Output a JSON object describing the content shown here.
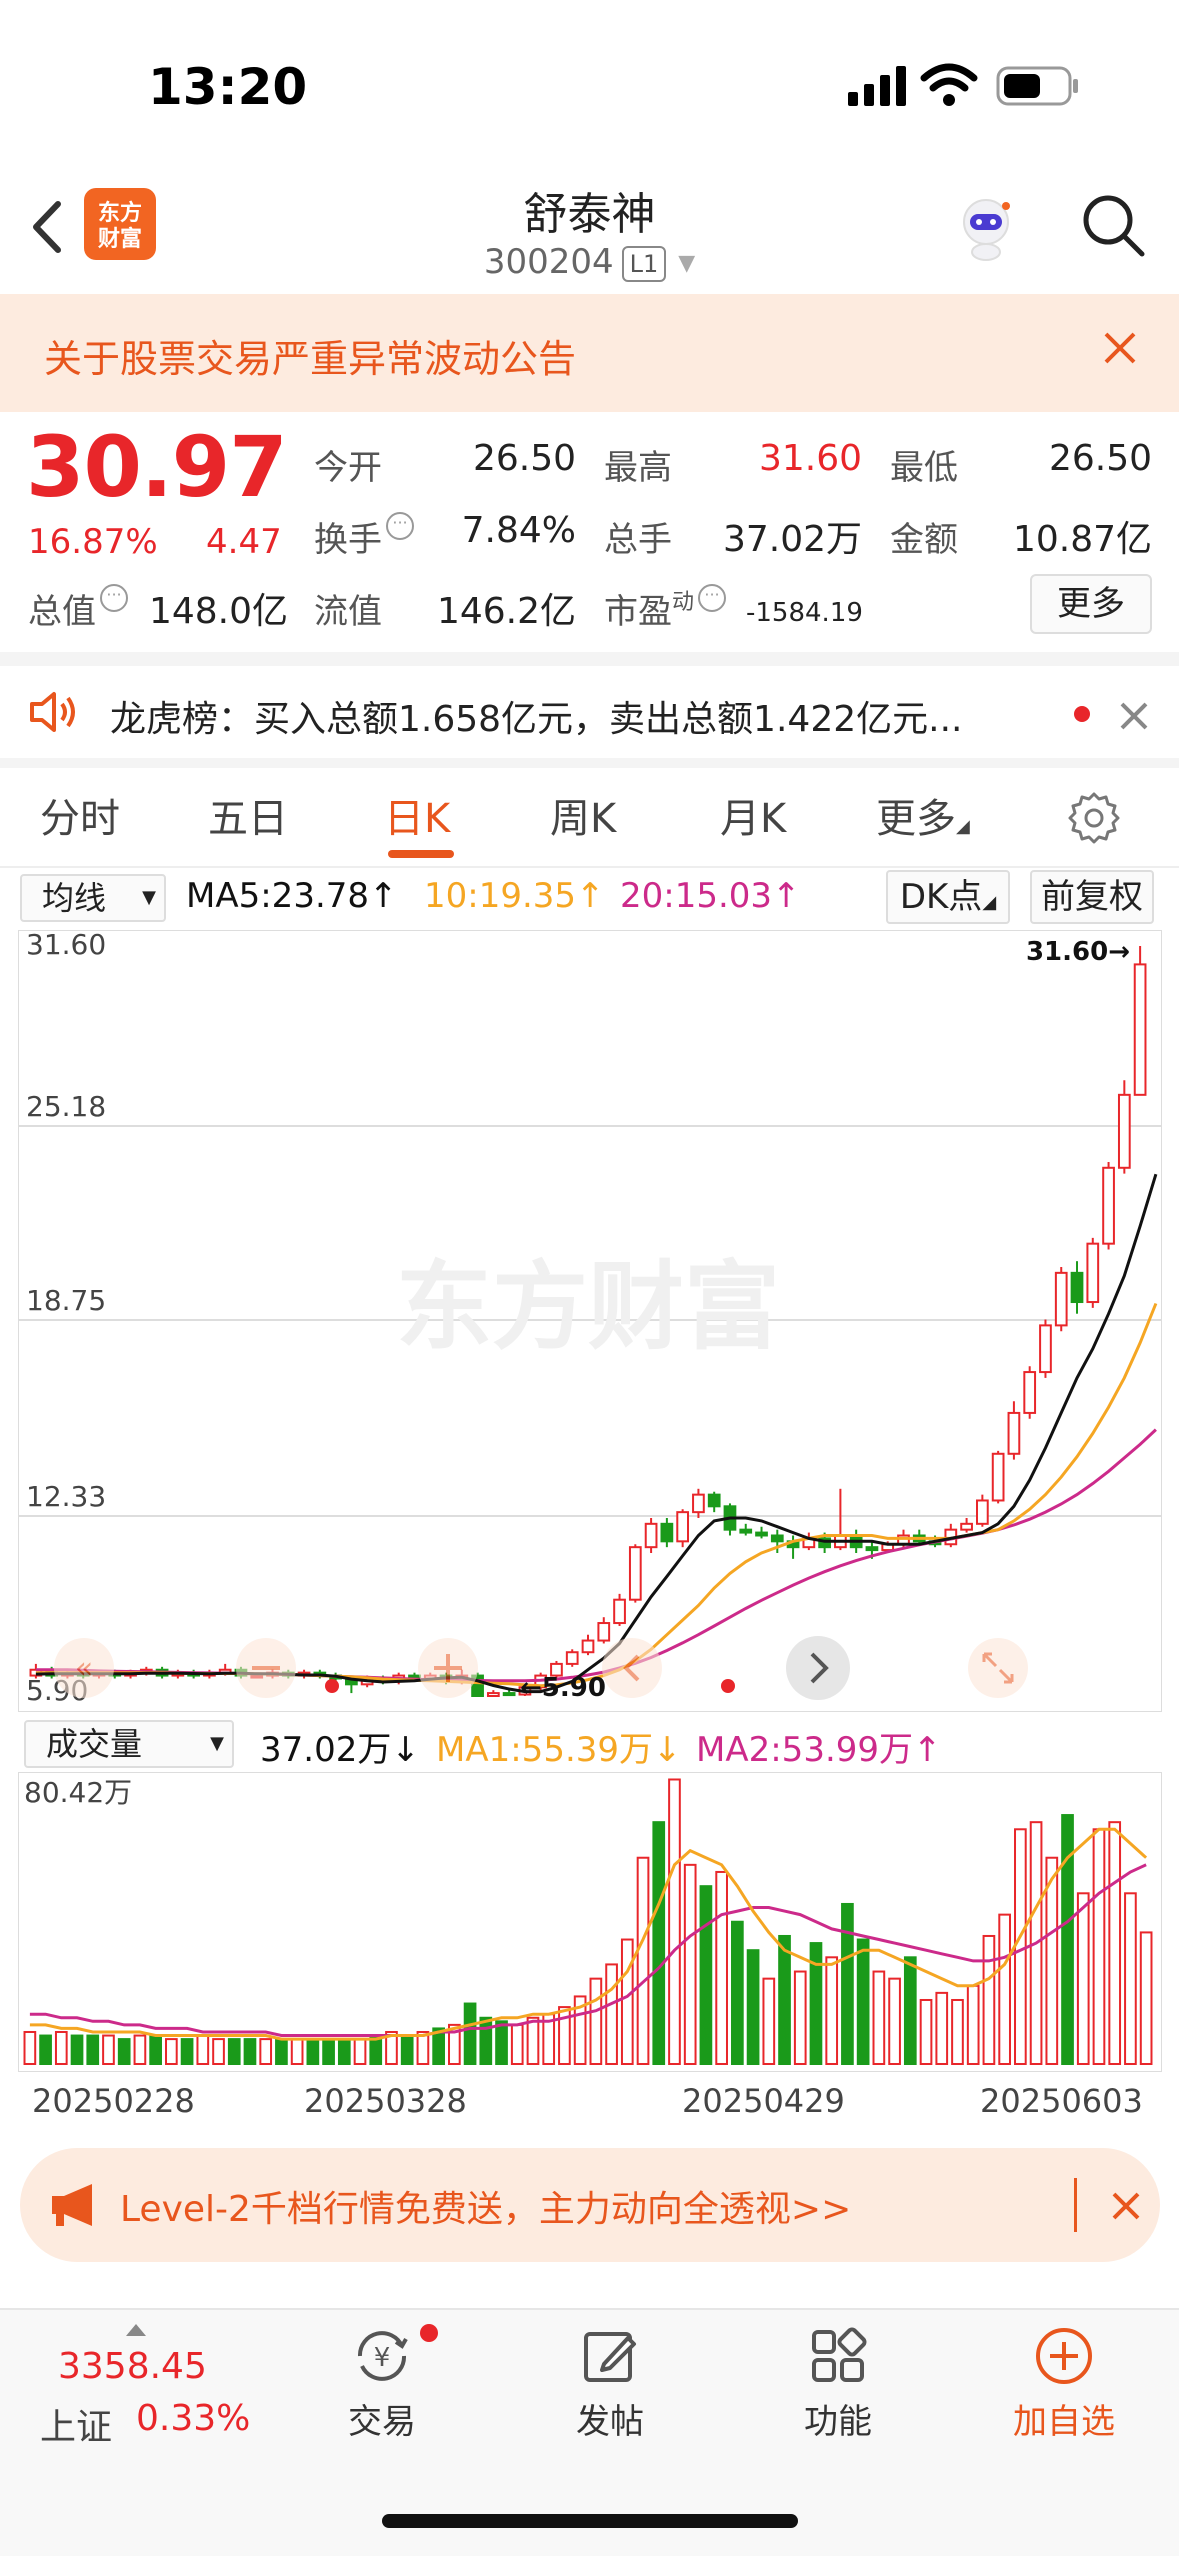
{
  "status_bar": {
    "time": "13:20"
  },
  "header": {
    "stock_name": "舒泰神",
    "stock_code": "300204",
    "level_badge": "L1",
    "logo_text": "东方财富"
  },
  "notice": {
    "text": "关于股票交易严重异常波动公告"
  },
  "quote": {
    "price": "30.97",
    "change_pct": "16.87%",
    "change": "4.47",
    "fields": {
      "open_label": "今开",
      "open": "26.50",
      "high_label": "最高",
      "high": "31.60",
      "low_label": "最低",
      "low": "26.50",
      "turnover_label": "换手",
      "turnover": "7.84%",
      "volume_label": "总手",
      "volume": "37.02万",
      "amount_label": "金额",
      "amount": "10.87亿",
      "mktcap_label": "总值",
      "mktcap": "148.0亿",
      "float_label": "流值",
      "float_cap": "146.2亿",
      "pe_label": "市盈",
      "pe_sup": "动",
      "pe": "-1584.19"
    },
    "more_label": "更多"
  },
  "dragon_tiger": {
    "text": "龙虎榜：买入总额1.658亿元，卖出总额1.422亿元..."
  },
  "tabs": [
    {
      "label": "分时"
    },
    {
      "label": "五日"
    },
    {
      "label": "日K"
    },
    {
      "label": "周K"
    },
    {
      "label": "月K"
    },
    {
      "label": "更多"
    }
  ],
  "ma_bar": {
    "select": "均线",
    "ma5": "MA5:23.78↑",
    "ma10": "10:19.35↑",
    "ma20": "20:15.03↑",
    "dk_label": "DK点",
    "adjust_label": "前复权"
  },
  "chart_labels": {
    "y_ticks": [
      "31.60",
      "25.18",
      "18.75",
      "12.33",
      "5.90"
    ],
    "high_marker": "31.60→",
    "low_marker": "←5.90",
    "watermark": "东方财富"
  },
  "volume_bar": {
    "select": "成交量",
    "vol": "37.02万↓",
    "ma1": "MA1:55.39万↓",
    "ma2": "MA2:53.99万↑",
    "max_label": "80.42万"
  },
  "dates": [
    "20250228",
    "20250328",
    "20250429",
    "20250603"
  ],
  "colors": {
    "up": "#e8262a",
    "down": "#1a9a1a",
    "ma5": "#111111",
    "ma10": "#f5a623",
    "ma20": "#cc2a8a",
    "accent": "#e8561d"
  },
  "chart_data": {
    "type": "candlestick",
    "y_range": [
      5.9,
      31.6
    ],
    "candles": [
      {
        "o": 6.6,
        "c": 6.8,
        "h": 7.0,
        "l": 6.5
      },
      {
        "o": 6.8,
        "c": 6.6,
        "h": 6.9,
        "l": 6.5
      },
      {
        "o": 6.6,
        "c": 6.7,
        "h": 6.8,
        "l": 6.5
      },
      {
        "o": 6.7,
        "c": 6.6,
        "h": 6.8,
        "l": 6.5
      },
      {
        "o": 6.6,
        "c": 6.7,
        "h": 6.8,
        "l": 6.5
      },
      {
        "o": 6.7,
        "c": 6.6,
        "h": 6.8,
        "l": 6.5
      },
      {
        "o": 6.6,
        "c": 6.7,
        "h": 6.8,
        "l": 6.5
      },
      {
        "o": 6.7,
        "c": 6.8,
        "h": 6.9,
        "l": 6.6
      },
      {
        "o": 6.8,
        "c": 6.6,
        "h": 6.9,
        "l": 6.5
      },
      {
        "o": 6.6,
        "c": 6.7,
        "h": 6.8,
        "l": 6.5
      },
      {
        "o": 6.7,
        "c": 6.6,
        "h": 6.8,
        "l": 6.5
      },
      {
        "o": 6.6,
        "c": 6.7,
        "h": 6.8,
        "l": 6.5
      },
      {
        "o": 6.7,
        "c": 6.8,
        "h": 7.0,
        "l": 6.6
      },
      {
        "o": 6.8,
        "c": 6.6,
        "h": 6.9,
        "l": 6.5
      },
      {
        "o": 6.6,
        "c": 6.6,
        "h": 6.7,
        "l": 6.5
      },
      {
        "o": 6.6,
        "c": 6.7,
        "h": 6.8,
        "l": 6.5
      },
      {
        "o": 6.7,
        "c": 6.6,
        "h": 6.8,
        "l": 6.5
      },
      {
        "o": 6.6,
        "c": 6.7,
        "h": 6.8,
        "l": 6.5
      },
      {
        "o": 6.7,
        "c": 6.6,
        "h": 6.8,
        "l": 6.5
      },
      {
        "o": 6.6,
        "c": 6.5,
        "h": 6.7,
        "l": 6.4
      },
      {
        "o": 6.5,
        "c": 6.3,
        "h": 6.6,
        "l": 6.0
      },
      {
        "o": 6.3,
        "c": 6.5,
        "h": 6.6,
        "l": 6.2
      },
      {
        "o": 6.5,
        "c": 6.4,
        "h": 6.6,
        "l": 6.3
      },
      {
        "o": 6.4,
        "c": 6.6,
        "h": 6.7,
        "l": 6.3
      },
      {
        "o": 6.6,
        "c": 6.5,
        "h": 6.7,
        "l": 6.4
      },
      {
        "o": 6.5,
        "c": 6.6,
        "h": 6.7,
        "l": 6.4
      },
      {
        "o": 6.6,
        "c": 6.4,
        "h": 6.7,
        "l": 6.3
      },
      {
        "o": 6.4,
        "c": 6.6,
        "h": 6.8,
        "l": 6.3
      },
      {
        "o": 6.6,
        "c": 5.9,
        "h": 6.7,
        "l": 5.9
      },
      {
        "o": 5.9,
        "c": 6.0,
        "h": 6.1,
        "l": 5.9
      },
      {
        "o": 6.0,
        "c": 5.95,
        "h": 6.1,
        "l": 5.9
      },
      {
        "o": 5.95,
        "c": 6.2,
        "h": 6.3,
        "l": 5.9
      },
      {
        "o": 6.2,
        "c": 6.6,
        "h": 6.7,
        "l": 6.1
      },
      {
        "o": 6.6,
        "c": 7.0,
        "h": 7.1,
        "l": 6.5
      },
      {
        "o": 7.0,
        "c": 7.4,
        "h": 7.5,
        "l": 6.9
      },
      {
        "o": 7.4,
        "c": 7.8,
        "h": 8.0,
        "l": 7.3
      },
      {
        "o": 7.8,
        "c": 8.4,
        "h": 8.6,
        "l": 7.7
      },
      {
        "o": 8.4,
        "c": 9.2,
        "h": 9.4,
        "l": 8.3
      },
      {
        "o": 9.2,
        "c": 11.0,
        "h": 11.1,
        "l": 9.1
      },
      {
        "o": 11.0,
        "c": 11.8,
        "h": 12.0,
        "l": 10.8
      },
      {
        "o": 11.8,
        "c": 11.2,
        "h": 12.0,
        "l": 11.0
      },
      {
        "o": 11.2,
        "c": 12.2,
        "h": 12.3,
        "l": 11.0
      },
      {
        "o": 12.2,
        "c": 12.8,
        "h": 13.0,
        "l": 12.0
      },
      {
        "o": 12.8,
        "c": 12.4,
        "h": 12.9,
        "l": 12.2
      },
      {
        "o": 12.4,
        "c": 11.6,
        "h": 12.5,
        "l": 11.4
      },
      {
        "o": 11.6,
        "c": 11.5,
        "h": 11.8,
        "l": 11.4
      },
      {
        "o": 11.5,
        "c": 11.4,
        "h": 11.7,
        "l": 11.3
      },
      {
        "o": 11.4,
        "c": 11.2,
        "h": 11.6,
        "l": 10.8
      },
      {
        "o": 11.2,
        "c": 11.0,
        "h": 11.4,
        "l": 10.6
      },
      {
        "o": 11.0,
        "c": 11.3,
        "h": 11.5,
        "l": 10.9
      },
      {
        "o": 11.3,
        "c": 11.0,
        "h": 11.5,
        "l": 10.8
      },
      {
        "o": 11.0,
        "c": 11.4,
        "h": 13.0,
        "l": 10.9
      },
      {
        "o": 11.4,
        "c": 11.0,
        "h": 11.6,
        "l": 10.8
      },
      {
        "o": 11.0,
        "c": 10.9,
        "h": 11.2,
        "l": 10.6
      },
      {
        "o": 10.9,
        "c": 11.1,
        "h": 11.2,
        "l": 10.8
      },
      {
        "o": 11.1,
        "c": 11.4,
        "h": 11.6,
        "l": 11.0
      },
      {
        "o": 11.4,
        "c": 11.2,
        "h": 11.6,
        "l": 11.1
      },
      {
        "o": 11.2,
        "c": 11.1,
        "h": 11.4,
        "l": 11.0
      },
      {
        "o": 11.1,
        "c": 11.6,
        "h": 11.8,
        "l": 11.0
      },
      {
        "o": 11.6,
        "c": 11.8,
        "h": 12.0,
        "l": 11.5
      },
      {
        "o": 11.8,
        "c": 12.6,
        "h": 12.8,
        "l": 11.7
      },
      {
        "o": 12.6,
        "c": 14.2,
        "h": 14.3,
        "l": 12.5
      },
      {
        "o": 14.2,
        "c": 15.6,
        "h": 16.0,
        "l": 14.0
      },
      {
        "o": 15.6,
        "c": 17.0,
        "h": 17.2,
        "l": 15.4
      },
      {
        "o": 17.0,
        "c": 18.6,
        "h": 18.8,
        "l": 16.8
      },
      {
        "o": 18.6,
        "c": 20.4,
        "h": 20.6,
        "l": 18.4
      },
      {
        "o": 20.4,
        "c": 19.4,
        "h": 20.8,
        "l": 19.0
      },
      {
        "o": 19.4,
        "c": 21.4,
        "h": 21.6,
        "l": 19.2
      },
      {
        "o": 21.4,
        "c": 24.0,
        "h": 24.2,
        "l": 21.2
      },
      {
        "o": 24.0,
        "c": 26.5,
        "h": 27.0,
        "l": 23.8
      },
      {
        "o": 26.5,
        "c": 30.97,
        "h": 31.6,
        "l": 26.5
      }
    ],
    "ma5_points": [
      6.65,
      6.66,
      6.66,
      6.66,
      6.66,
      6.66,
      6.66,
      6.68,
      6.68,
      6.68,
      6.67,
      6.66,
      6.68,
      6.68,
      6.66,
      6.66,
      6.64,
      6.62,
      6.62,
      6.58,
      6.48,
      6.42,
      6.38,
      6.4,
      6.42,
      6.48,
      6.52,
      6.54,
      6.42,
      6.26,
      6.14,
      6.05,
      6.05,
      6.2,
      6.4,
      6.8,
      7.2,
      7.7,
      8.5,
      9.3,
      10.0,
      10.7,
      11.4,
      11.9,
      12.0,
      12.0,
      11.9,
      11.7,
      11.5,
      11.3,
      11.2,
      11.2,
      11.2,
      11.2,
      11.1,
      11.1,
      11.1,
      11.2,
      11.3,
      11.4,
      11.5,
      11.8,
      12.4,
      13.3,
      14.4,
      15.6,
      16.8,
      17.8,
      19.0,
      20.3,
      22.0,
      23.78
    ],
    "ma10_points": [
      6.7,
      6.7,
      6.7,
      6.7,
      6.7,
      6.7,
      6.7,
      6.7,
      6.7,
      6.68,
      6.67,
      6.67,
      6.67,
      6.67,
      6.66,
      6.65,
      6.64,
      6.62,
      6.6,
      6.58,
      6.56,
      6.52,
      6.48,
      6.46,
      6.44,
      6.42,
      6.4,
      6.38,
      6.36,
      6.34,
      6.32,
      6.28,
      6.25,
      6.28,
      6.35,
      6.46,
      6.6,
      6.8,
      7.1,
      7.5,
      8.0,
      8.5,
      9.0,
      9.6,
      10.1,
      10.5,
      10.8,
      11.0,
      11.2,
      11.3,
      11.4,
      11.4,
      11.4,
      11.4,
      11.3,
      11.3,
      11.3,
      11.3,
      11.3,
      11.4,
      11.5,
      11.6,
      11.9,
      12.3,
      12.8,
      13.4,
      14.1,
      14.9,
      15.8,
      16.8,
      18.0,
      19.35
    ],
    "ma20_points": [
      6.8,
      6.8,
      6.8,
      6.78,
      6.76,
      6.75,
      6.74,
      6.73,
      6.72,
      6.71,
      6.7,
      6.69,
      6.68,
      6.67,
      6.66,
      6.65,
      6.64,
      6.62,
      6.6,
      6.58,
      6.56,
      6.54,
      6.52,
      6.5,
      6.48,
      6.46,
      6.45,
      6.44,
      6.43,
      6.42,
      6.42,
      6.42,
      6.44,
      6.48,
      6.54,
      6.62,
      6.72,
      6.86,
      7.02,
      7.22,
      7.46,
      7.72,
      8.0,
      8.3,
      8.6,
      8.9,
      9.18,
      9.44,
      9.7,
      9.94,
      10.16,
      10.36,
      10.54,
      10.7,
      10.84,
      10.96,
      11.08,
      11.18,
      11.28,
      11.38,
      11.48,
      11.6,
      11.76,
      11.96,
      12.2,
      12.48,
      12.8,
      13.18,
      13.6,
      14.06,
      14.52,
      15.03
    ],
    "volume_max": 80.42,
    "volumes": [
      9,
      8,
      9,
      8,
      8,
      8,
      7,
      8,
      8,
      7,
      7,
      8,
      7,
      7,
      7,
      7,
      7,
      7,
      7,
      7,
      7,
      7,
      8,
      9,
      8,
      9,
      10,
      11,
      17,
      13,
      12,
      11,
      13,
      14,
      16,
      19,
      24,
      28,
      35,
      58,
      68,
      80,
      56,
      50,
      54,
      40,
      32,
      24,
      36,
      26,
      34,
      30,
      45,
      35,
      26,
      24,
      30,
      18,
      20,
      18,
      22,
      36,
      42,
      66,
      68,
      58,
      70,
      48,
      66,
      68,
      48,
      37
    ],
    "volume_up": [
      1,
      0,
      1,
      0,
      0,
      1,
      0,
      1,
      0,
      1,
      0,
      1,
      1,
      0,
      0,
      1,
      0,
      1,
      0,
      0,
      0,
      1,
      0,
      1,
      0,
      1,
      0,
      1,
      0,
      0,
      0,
      1,
      1,
      1,
      1,
      1,
      1,
      1,
      1,
      1,
      0,
      1,
      1,
      0,
      1,
      0,
      0,
      1,
      0,
      1,
      0,
      1,
      0,
      0,
      1,
      1,
      0,
      1,
      1,
      1,
      1,
      1,
      1,
      1,
      1,
      1,
      0,
      1,
      1,
      1,
      1,
      1
    ],
    "volume_ma1": [
      11,
      11,
      10,
      10,
      9,
      9,
      9,
      9,
      8,
      8,
      8,
      8,
      8,
      8,
      8,
      8,
      7,
      7,
      7,
      7,
      7,
      7,
      7,
      8,
      8,
      8,
      9,
      10,
      11,
      12,
      13,
      13,
      14,
      14,
      15,
      16,
      18,
      21,
      26,
      35,
      45,
      56,
      60,
      58,
      56,
      50,
      43,
      37,
      32,
      30,
      28,
      28,
      30,
      32,
      32,
      30,
      28,
      26,
      24,
      22,
      22,
      24,
      28,
      36,
      44,
      52,
      58,
      62,
      66,
      66,
      62,
      58
    ],
    "volume_ma2": [
      14,
      14,
      13,
      13,
      12,
      12,
      11,
      11,
      10,
      10,
      10,
      9,
      9,
      9,
      9,
      9,
      8,
      8,
      8,
      8,
      8,
      8,
      8,
      8,
      8,
      8,
      9,
      9,
      10,
      10,
      11,
      11,
      12,
      12,
      13,
      14,
      15,
      17,
      19,
      23,
      27,
      32,
      36,
      39,
      42,
      43,
      44,
      44,
      43,
      42,
      40,
      38,
      37,
      36,
      35,
      34,
      33,
      32,
      31,
      30,
      29,
      29,
      30,
      32,
      34,
      37,
      40,
      44,
      48,
      51,
      54,
      56
    ]
  },
  "bottom_bar": {
    "index_value": "3358.45",
    "index_name": "上证",
    "index_pct": "0.33%",
    "items": [
      {
        "label": "交易"
      },
      {
        "label": "发帖"
      },
      {
        "label": "功能"
      },
      {
        "label": "加自选"
      }
    ]
  }
}
